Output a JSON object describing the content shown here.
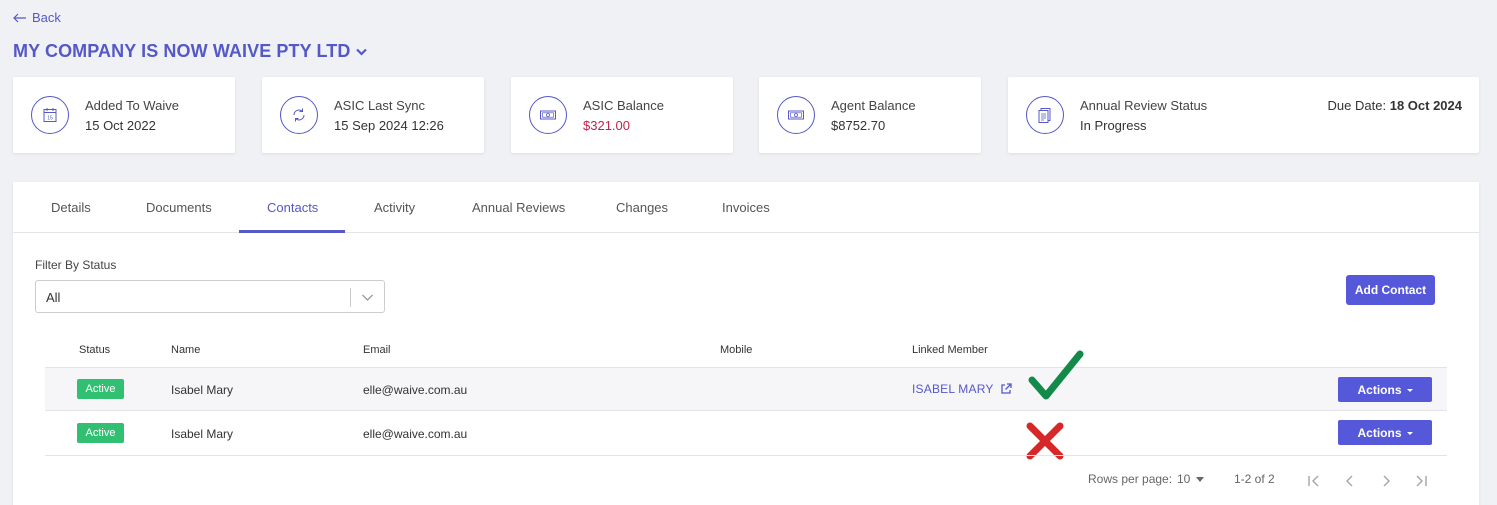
{
  "back": {
    "label": "Back"
  },
  "company": {
    "name": "MY COMPANY IS NOW WAIVE PTY LTD"
  },
  "cards": [
    {
      "label": "Added To Waive",
      "value": "15 Oct 2022",
      "icon": "calendar-icon"
    },
    {
      "label": "ASIC Last Sync",
      "value": "15 Sep 2024 12:26",
      "icon": "sync-icon"
    },
    {
      "label": "ASIC Balance",
      "value": "$321.00",
      "value_color": "#c0244a",
      "icon": "money-icon"
    },
    {
      "label": "Agent Balance",
      "value": "$8752.70",
      "icon": "money-icon"
    },
    {
      "label": "Annual Review Status",
      "value": "In Progress",
      "icon": "document-icon",
      "due_label": "Due Date:",
      "due_value": "18 Oct 2024"
    }
  ],
  "tabs": [
    "Details",
    "Documents",
    "Contacts",
    "Activity",
    "Annual Reviews",
    "Changes",
    "Invoices"
  ],
  "active_tab": "Contacts",
  "filter": {
    "label": "Filter By Status",
    "value": "All"
  },
  "add_contact": {
    "label": "Add Contact"
  },
  "table": {
    "headers": [
      "Status",
      "Name",
      "Email",
      "Mobile",
      "Linked Member"
    ],
    "rows": [
      {
        "status": "Active",
        "name": "Isabel Mary",
        "email": "elle@waive.com.au",
        "mobile": "",
        "linked_member": "ISABEL MARY",
        "actions": "Actions",
        "mark": "check"
      },
      {
        "status": "Active",
        "name": "Isabel Mary",
        "email": "elle@waive.com.au",
        "mobile": "",
        "linked_member": "",
        "actions": "Actions",
        "mark": "cross"
      }
    ]
  },
  "pagination": {
    "rows_per_page_label": "Rows per page:",
    "rows_per_page": "10",
    "range": "1-2 of 2"
  },
  "colors": {
    "accent": "#5558c7",
    "button": "#5558d9",
    "active_badge": "#31c071",
    "check": "#138a4a",
    "cross": "#d62828"
  }
}
